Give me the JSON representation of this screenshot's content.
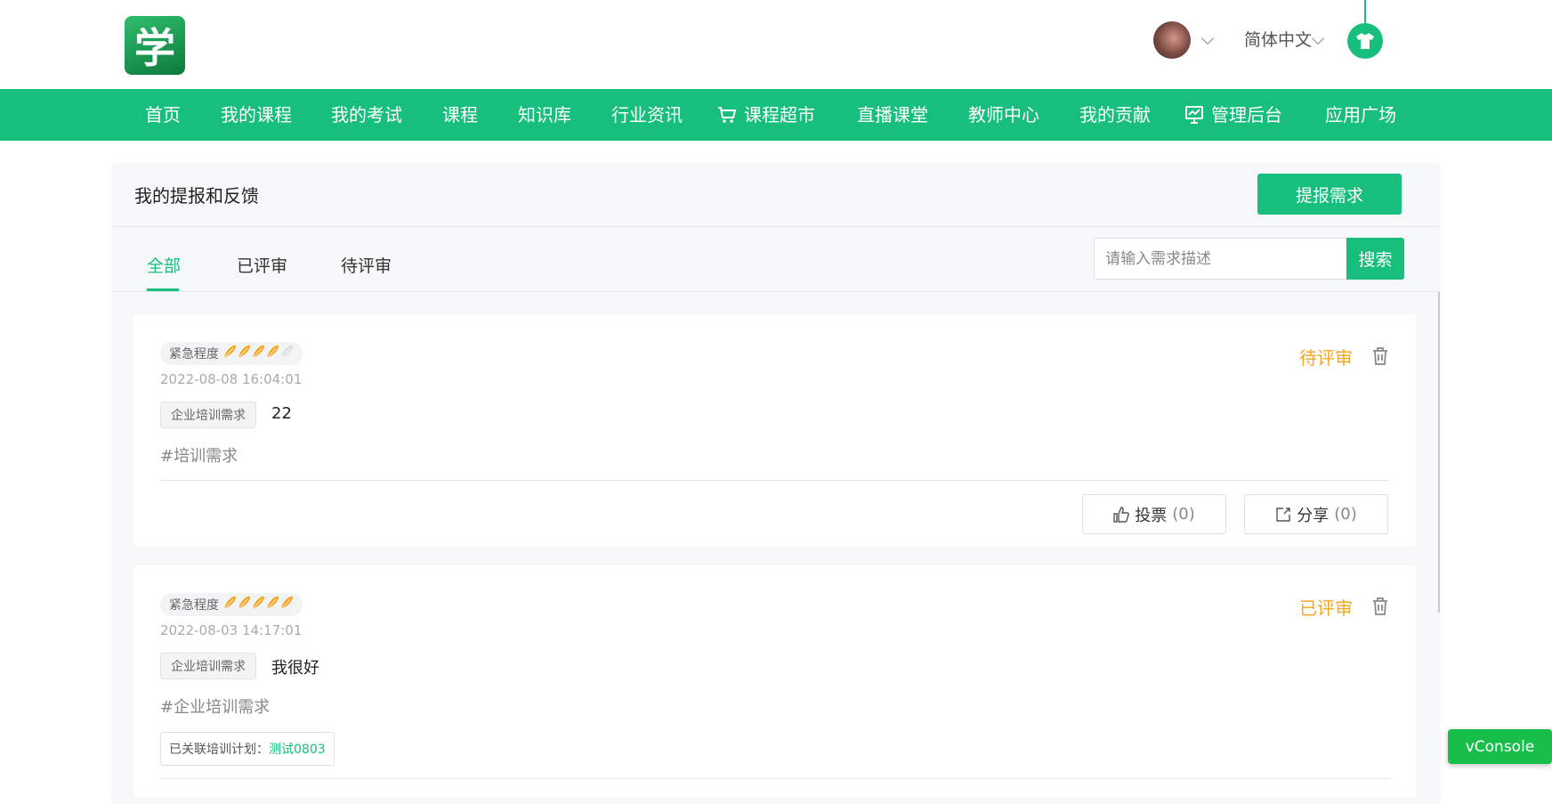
{
  "header": {
    "logo_char": "学",
    "language": "简体中文"
  },
  "nav": [
    {
      "label": "首页",
      "icon": ""
    },
    {
      "label": "我的课程",
      "icon": ""
    },
    {
      "label": "我的考试",
      "icon": ""
    },
    {
      "label": "课程",
      "icon": ""
    },
    {
      "label": "知识库",
      "icon": ""
    },
    {
      "label": "行业资讯",
      "icon": ""
    },
    {
      "label": "课程超市",
      "icon": "cart-icon"
    },
    {
      "label": "直播课堂",
      "icon": ""
    },
    {
      "label": "教师中心",
      "icon": ""
    },
    {
      "label": "我的贡献",
      "icon": ""
    },
    {
      "label": "管理后台",
      "icon": "monitor-chart-icon"
    },
    {
      "label": "应用广场",
      "icon": ""
    }
  ],
  "page": {
    "title": "我的提报和反馈",
    "report_button": "提报需求",
    "tabs": [
      "全部",
      "已评审",
      "待评审"
    ],
    "active_tab": 0,
    "search_placeholder": "请输入需求描述",
    "search_button": "搜索"
  },
  "colors": {
    "primary": "#17be7c",
    "status": "#f5a623",
    "feather_active": "#f5a623",
    "feather_inactive": "#dddddd"
  },
  "cards": [
    {
      "urgency_label": "紧急程度",
      "urgency_level": 4,
      "urgency_max": 5,
      "date": "2022-08-08 16:04:01",
      "type": "企业培训需求",
      "description": "22",
      "hashtag": "#培训需求",
      "status": "待评审",
      "vote_label": "投票",
      "vote_count": "(0)",
      "share_label": "分享",
      "share_count": "(0)"
    },
    {
      "urgency_label": "紧急程度",
      "urgency_level": 5,
      "urgency_max": 5,
      "date": "2022-08-03 14:17:01",
      "type": "企业培训需求",
      "description": "我很好",
      "hashtag": "#企业培训需求",
      "status": "已评审",
      "plan_label": "已关联培训计划：",
      "plan_link": "测试0803"
    }
  ],
  "vconsole": "vConsole"
}
